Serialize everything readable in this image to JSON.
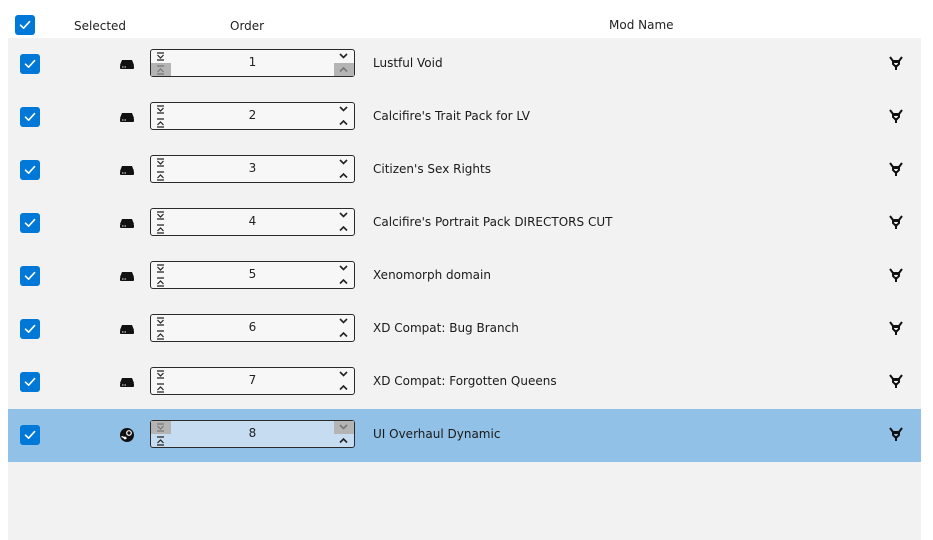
{
  "header": {
    "selected_label": "Selected",
    "order_label": "Order",
    "mod_name_label": "Mod Name"
  },
  "colors": {
    "accent": "#0078d7",
    "list_bg": "#f2f2f2",
    "selected_row_bg": "#91c1e7"
  },
  "mods": [
    {
      "order": "1",
      "name": "Lustful Void",
      "source": "local-drive-icon",
      "checked": true
    },
    {
      "order": "2",
      "name": "Calcifire's Trait Pack for LV",
      "source": "local-drive-icon",
      "checked": true
    },
    {
      "order": "3",
      "name": "Citizen's Sex Rights",
      "source": "local-drive-icon",
      "checked": true
    },
    {
      "order": "4",
      "name": "Calcifire's Portrait Pack DIRECTORS CUT",
      "source": "local-drive-icon",
      "checked": true
    },
    {
      "order": "5",
      "name": "Xenomorph domain",
      "source": "local-drive-icon",
      "checked": true
    },
    {
      "order": "6",
      "name": "XD Compat: Bug Branch",
      "source": "local-drive-icon",
      "checked": true
    },
    {
      "order": "7",
      "name": "XD Compat: Forgotten Queens",
      "source": "local-drive-icon",
      "checked": true
    },
    {
      "order": "8",
      "name": "UI Overhaul Dynamic",
      "source": "steam-icon",
      "checked": true,
      "selected": true
    }
  ]
}
